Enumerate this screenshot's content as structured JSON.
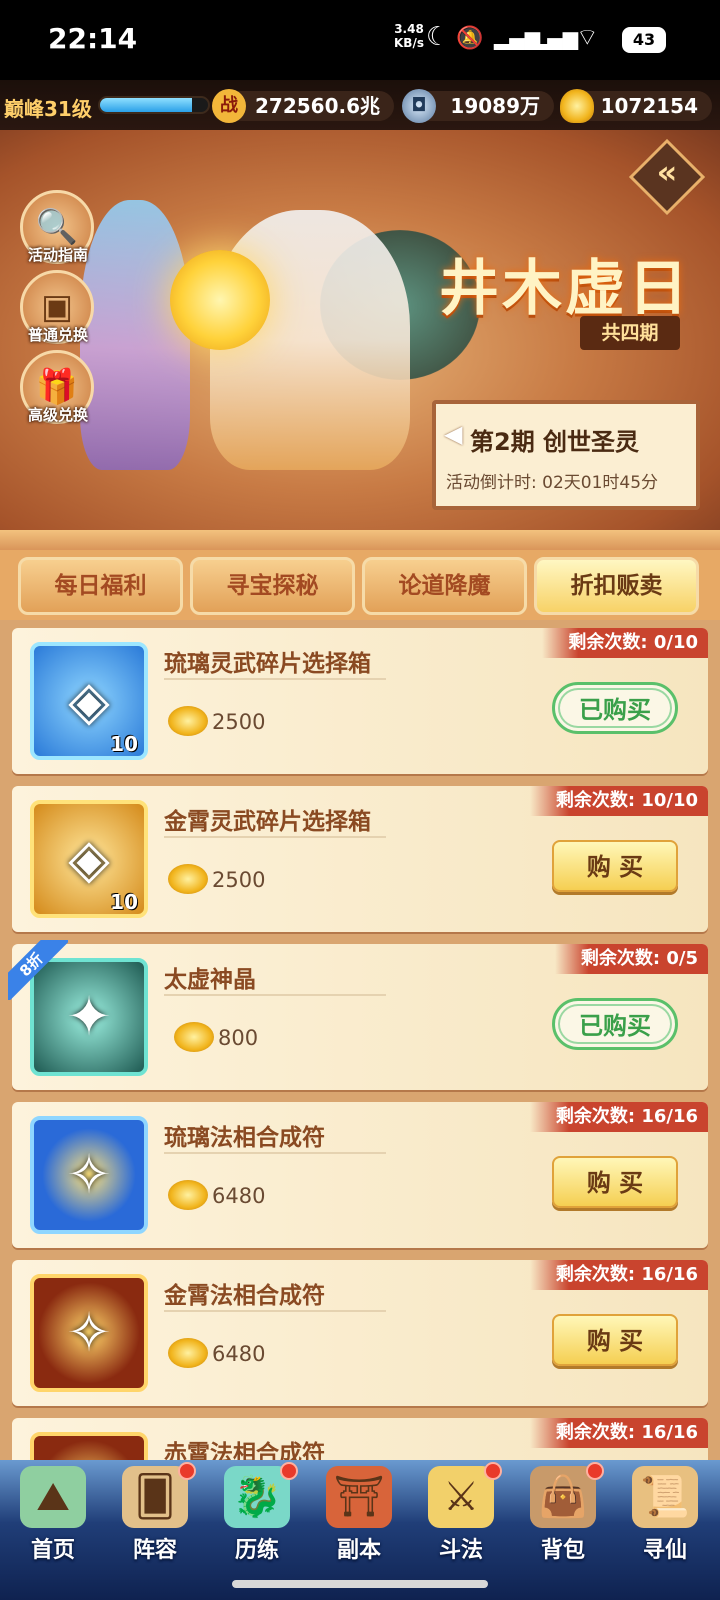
{
  "status_bar": {
    "time": "22:14",
    "net_speed_value": "3.48",
    "net_speed_unit": "KB/s",
    "battery": "43",
    "icons": [
      "moon-icon",
      "mute-icon",
      "signal-icon",
      "4g-signal-icon",
      "wifi-icon"
    ]
  },
  "resources": {
    "level": "巅峰31级",
    "xp_fraction": 0.85,
    "power": "272560.6兆",
    "power_icon": "战",
    "coins": "19089万",
    "ingots": "1072154"
  },
  "side_buttons": [
    {
      "label": "活动指南",
      "icon": "magnifier-icon"
    },
    {
      "label": "普通兑换",
      "icon": "chest-icon"
    },
    {
      "label": "高级兑换",
      "icon": "gift-icon"
    }
  ],
  "event": {
    "title": "井木虚日",
    "periods": "共四期",
    "phase": "第2期  创世圣灵",
    "countdown": "活动倒计时: 02天01时45分"
  },
  "tabs": [
    {
      "label": "每日福利",
      "active": false
    },
    {
      "label": "寻宝探秘",
      "active": false
    },
    {
      "label": "论道降魔",
      "active": false
    },
    {
      "label": "折扣贩卖",
      "active": true
    }
  ],
  "items": [
    {
      "name": "琉璃灵武碎片选择箱",
      "price": "2500",
      "remaining": "剩余次数: 0/10",
      "quantity": "10",
      "action": "已购买",
      "state": "bought",
      "icon_style": "blue",
      "discount": ""
    },
    {
      "name": "金霄灵武碎片选择箱",
      "price": "2500",
      "remaining": "剩余次数: 10/10",
      "quantity": "10",
      "action": "购 买",
      "state": "buy",
      "icon_style": "gold",
      "discount": ""
    },
    {
      "name": "太虚神晶",
      "price": "800",
      "remaining": "剩余次数: 0/5",
      "quantity": "",
      "action": "已购买",
      "state": "bought",
      "icon_style": "teal",
      "discount": "8折"
    },
    {
      "name": "琉璃法相合成符",
      "price": "6480",
      "remaining": "剩余次数: 16/16",
      "quantity": "",
      "action": "购 买",
      "state": "buy",
      "icon_style": "bluegold",
      "discount": ""
    },
    {
      "name": "金霄法相合成符",
      "price": "6480",
      "remaining": "剩余次数: 16/16",
      "quantity": "",
      "action": "购 买",
      "state": "buy",
      "icon_style": "red",
      "discount": ""
    },
    {
      "name": "赤霄法相合成符",
      "price": "",
      "remaining": "剩余次数: 16/16",
      "quantity": "",
      "action": "",
      "state": "partial",
      "icon_style": "red",
      "discount": ""
    }
  ],
  "nav": [
    {
      "label": "首页",
      "icon": "home-island-icon",
      "badge": false
    },
    {
      "label": "阵容",
      "icon": "cards-icon",
      "badge": true
    },
    {
      "label": "历练",
      "icon": "dragon-icon",
      "badge": true
    },
    {
      "label": "副本",
      "icon": "pagoda-icon",
      "badge": false
    },
    {
      "label": "斗法",
      "icon": "crossed-swords-icon",
      "badge": true
    },
    {
      "label": "背包",
      "icon": "bag-icon",
      "badge": true
    },
    {
      "label": "寻仙",
      "icon": "scroll-icon",
      "badge": false
    }
  ]
}
